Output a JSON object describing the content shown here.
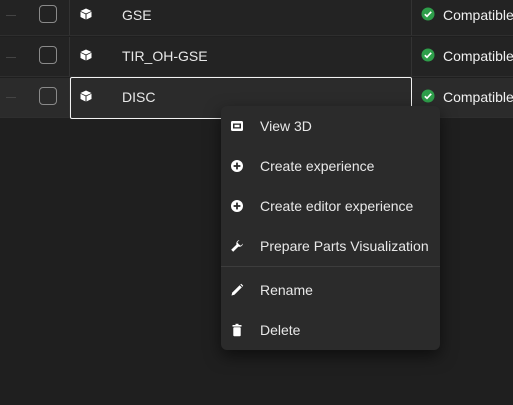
{
  "rows": [
    {
      "name": "GSE",
      "status": "Compatible",
      "type_icon": "cube-icon",
      "status_icon": "check-circle-icon"
    },
    {
      "name": "TIR_OH-GSE",
      "status": "Compatible",
      "type_icon": "cube-icon",
      "status_icon": "check-circle-icon"
    },
    {
      "name": "DISC",
      "status": "Compatible",
      "type_icon": "cube-icon",
      "status_icon": "check-circle-icon"
    }
  ],
  "context_menu": {
    "items": [
      {
        "label": "View 3D",
        "icon": "view-3d-icon"
      },
      {
        "label": "Create experience",
        "icon": "add-circle-icon"
      },
      {
        "label": "Create editor experience",
        "icon": "add-circle-icon"
      },
      {
        "label": "Prepare Parts Visualization",
        "icon": "wrench-icon"
      },
      {
        "label": "Rename",
        "icon": "pencil-icon"
      },
      {
        "label": "Delete",
        "icon": "trash-icon"
      }
    ]
  },
  "colors": {
    "background": "#1f1f1f",
    "row_background": "#232323",
    "menu_background": "#2b2b2b",
    "status_green": "#2e9e4a",
    "text": "#e8e8e8"
  }
}
